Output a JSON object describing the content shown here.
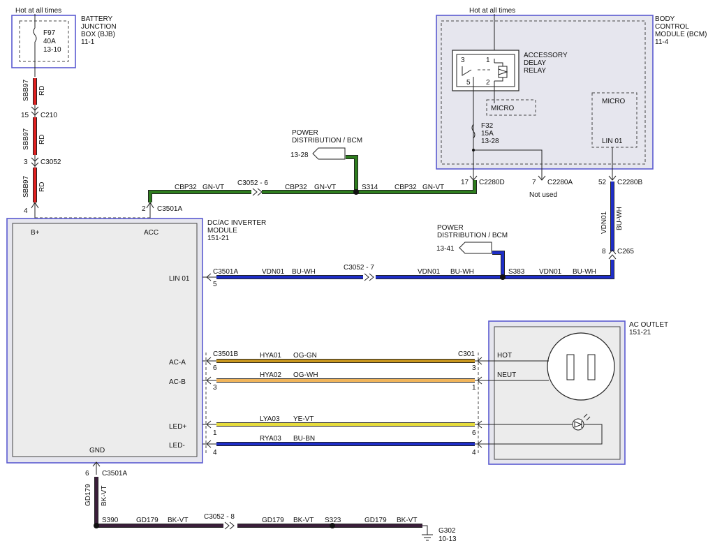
{
  "colors": {
    "red": "#e02020",
    "green": "#2e7d1e",
    "blue": "#1e2ec8",
    "orange_green": "#c8961e",
    "orange_white": "#f0b45a",
    "yellow_violet": "#e6dc3c",
    "blue_brown": "#1e2ec8",
    "black_violet": "#3a1e3a",
    "module_border": "#5a5ad0",
    "module_fill": "#e6e6ee"
  },
  "bjb": {
    "hot_label": "Hot at all times",
    "title": [
      "BATTERY",
      "JUNCTION",
      "BOX (BJB)",
      "11-1"
    ],
    "fuse": [
      "F97",
      "40A",
      "13-10"
    ]
  },
  "wire_sbb97": {
    "circuit": "SBB97",
    "color": "RD"
  },
  "c210": {
    "pin": "15",
    "name": "C210"
  },
  "c3052_top": {
    "pin": "3",
    "name": "C3052"
  },
  "bcm": {
    "hot_label": "Hot at all times",
    "title": [
      "BODY",
      "CONTROL",
      "MODULE (BCM)",
      "11-4"
    ],
    "relay": [
      "ACCESSORY",
      "DELAY",
      "RELAY"
    ],
    "relay_pins": [
      "1",
      "3",
      "5",
      "2"
    ],
    "micro_left": "MICRO",
    "micro_right": "MICRO",
    "lin_label": "LIN 01",
    "fuse": [
      "F32",
      "15A",
      "13-28"
    ]
  },
  "connectors_top": {
    "c2280d": {
      "pin": "17",
      "name": "C2280D"
    },
    "c2280a": {
      "pin": "7",
      "name": "C2280A",
      "note": "Not used"
    },
    "c2280b": {
      "pin": "52",
      "name": "C2280B"
    }
  },
  "pd_top": {
    "title": [
      "POWER",
      "DISTRIBUTION / BCM"
    ],
    "ref": "13-28",
    "splice": "S314"
  },
  "pd_mid": {
    "title": [
      "POWER",
      "DISTRIBUTION / BCM"
    ],
    "ref": "13-41",
    "splice": "S383"
  },
  "cbp32": {
    "label1": "CBP32",
    "color1": "GN-VT",
    "connector": "C3052 - 6",
    "label2": "CBP32",
    "color2": "GN-VT",
    "label3": "CBP32",
    "color3": "GN-VT"
  },
  "vdn01_vertical": {
    "circuit": "VDN01",
    "color": "BU-WH",
    "pin": "8",
    "connector": "C265"
  },
  "lin_row": {
    "conn": "C3501A",
    "pin": "5",
    "seg1_circuit": "VDN01",
    "seg1_color": "BU-WH",
    "mid_conn": "C3052 - 7",
    "seg2_circuit": "VDN01",
    "seg2_color": "BU-WH",
    "seg3_circuit": "VDN01",
    "seg3_color": "BU-WH"
  },
  "inverter": {
    "title": [
      "DC/AC INVERTER",
      "MODULE",
      "151-21"
    ],
    "b_plus": "B+",
    "acc": "ACC",
    "b_plus_pin": "4",
    "acc_pin": "2",
    "acc_conn": "C3501A",
    "lin": "LIN 01",
    "ac_a": "AC-A",
    "ac_b": "AC-B",
    "led_pos": "LED+",
    "led_neg": "LED-",
    "gnd": "GND"
  },
  "ac_wires": {
    "left_conn": "C3501B",
    "right_conn": "C301",
    "hya01": {
      "circuit": "HYA01",
      "color": "OG-GN",
      "pin_l": "6",
      "pin_r": "3"
    },
    "hya02": {
      "circuit": "HYA02",
      "color": "OG-WH",
      "pin_l": "3",
      "pin_r": "1"
    },
    "lya03": {
      "circuit": "LYA03",
      "color": "YE-VT",
      "pin_l": "1",
      "pin_r": "6"
    },
    "rya03": {
      "circuit": "RYA03",
      "color": "BU-BN",
      "pin_l": "4",
      "pin_r": "4"
    }
  },
  "ac_outlet": {
    "title": [
      "AC OUTLET",
      "151-21"
    ],
    "hot": "HOT",
    "neut": "NEUT"
  },
  "ground": {
    "pin": "6",
    "conn": "C3501A",
    "circuit": "GD179",
    "color": "BK-VT",
    "splice1": "S390",
    "seg1_circuit": "GD179",
    "seg1_color": "BK-VT",
    "mid_conn": "C3052 - 8",
    "seg2_circuit": "GD179",
    "seg2_color": "BK-VT",
    "splice2": "S323",
    "seg3_circuit": "GD179",
    "seg3_color": "BK-VT",
    "g_name": "G302",
    "g_ref": "10-13"
  }
}
